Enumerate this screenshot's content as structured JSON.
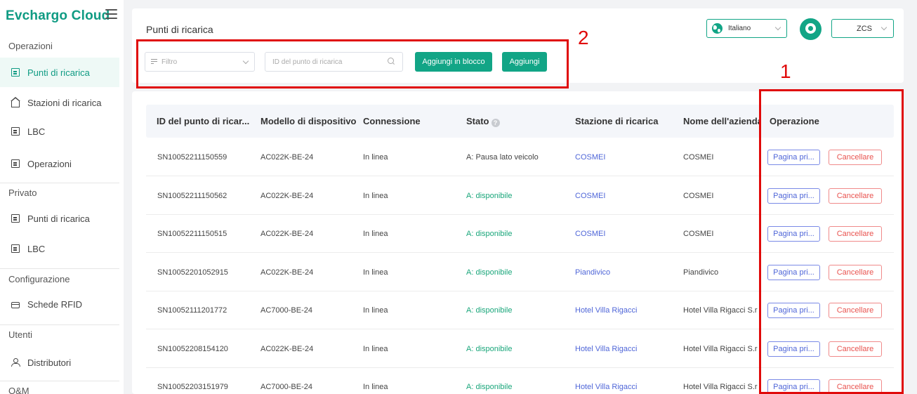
{
  "app": {
    "logo_text": "Evchargo Cloud"
  },
  "sidebar": {
    "sections": [
      {
        "label": "Operazioni"
      },
      {
        "label": "Privato"
      },
      {
        "label": "Configurazione"
      },
      {
        "label": "Utenti"
      },
      {
        "label": "O&M"
      }
    ],
    "items": [
      {
        "label": "Punti di ricarica",
        "icon": "charging-point-icon",
        "active": true
      },
      {
        "label": "Stazioni di ricarica",
        "icon": "house-icon"
      },
      {
        "label": "LBC",
        "icon": "device-icon"
      },
      {
        "label": "Operazioni",
        "icon": "document-icon"
      },
      {
        "label": "Punti di ricarica",
        "icon": "charging-point-icon"
      },
      {
        "label": "LBC",
        "icon": "device-icon"
      },
      {
        "label": "Schede RFID",
        "icon": "card-icon"
      },
      {
        "label": "Distributori",
        "icon": "users-icon"
      }
    ]
  },
  "header": {
    "title": "Punti di ricarica",
    "filter_placeholder": "Filtro",
    "search_placeholder": "ID del punto di ricarica",
    "bulk_add_label": "Aggiungi in blocco",
    "add_label": "Aggiungi",
    "language": "Italiano",
    "account": "ZCS"
  },
  "table": {
    "columns": [
      "ID del punto di ricar...",
      "Modello di dispositivo",
      "Connessione",
      "Stato",
      "Stazione di ricarica",
      "Nome dell'azienda",
      "Operazione"
    ],
    "rows": [
      {
        "id": "SN10052211150559",
        "model": "AC022K-BE-24",
        "connection": "In linea",
        "status": "A: Pausa lato veicolo",
        "status_color": "#444444",
        "station": "COSMEI",
        "company": "COSMEI"
      },
      {
        "id": "SN10052211150562",
        "model": "AC022K-BE-24",
        "connection": "In linea",
        "status": "A: disponibile",
        "status_color": "#19a67a",
        "station": "COSMEI",
        "company": "COSMEI"
      },
      {
        "id": "SN10052211150515",
        "model": "AC022K-BE-24",
        "connection": "In linea",
        "status": "A: disponibile",
        "status_color": "#19a67a",
        "station": "COSMEI",
        "company": "COSMEI"
      },
      {
        "id": "SN10052201052915",
        "model": "AC022K-BE-24",
        "connection": "In linea",
        "status": "A: disponibile",
        "status_color": "#19a67a",
        "station": "Piandivico",
        "company": "Piandivico"
      },
      {
        "id": "SN10052111201772",
        "model": "AC7000-BE-24",
        "connection": "In linea",
        "status": "A: disponibile",
        "status_color": "#19a67a",
        "station": "Hotel Villa Rigacci",
        "company": "Hotel Villa Rigacci S.r"
      },
      {
        "id": "SN10052208154120",
        "model": "AC022K-BE-24",
        "connection": "In linea",
        "status": "A: disponibile",
        "status_color": "#19a67a",
        "station": "Hotel Villa Rigacci",
        "company": "Hotel Villa Rigacci S.r"
      },
      {
        "id": "SN10052203151979",
        "model": "AC7000-BE-24",
        "connection": "In linea",
        "status": "A: disponibile",
        "status_color": "#19a67a",
        "station": "Hotel Villa Rigacci",
        "company": "Hotel Villa Rigacci S.r"
      }
    ],
    "actions": {
      "home_label": "Pagina pri...",
      "delete_label": "Cancellare"
    }
  },
  "annotations": {
    "label_1": "1",
    "label_2": "2",
    "color": "#e00a0a"
  },
  "colors": {
    "brand": "#12a586",
    "link": "#4f66d8",
    "danger": "#e9534f"
  }
}
